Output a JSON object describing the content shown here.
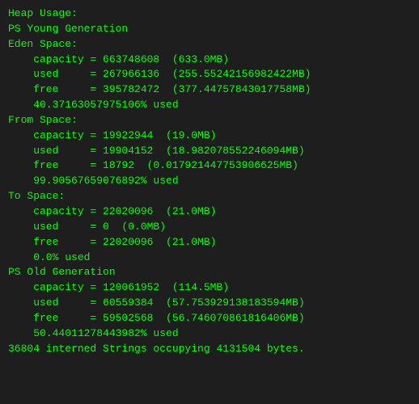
{
  "content": {
    "lines": [
      {
        "text": "Heap Usage:",
        "indent": 0
      },
      {
        "text": "PS Young Generation",
        "indent": 0
      },
      {
        "text": "Eden Space:",
        "indent": 0
      },
      {
        "text": "    capacity = 663748608  (633.0MB)",
        "indent": 0
      },
      {
        "text": "    used     = 267966136  (255.55242156982422MB)",
        "indent": 0
      },
      {
        "text": "    free     = 395782472  (377.44757843017758MB)",
        "indent": 0
      },
      {
        "text": "    40.37163057975106% used",
        "indent": 0
      },
      {
        "text": "From Space:",
        "indent": 0
      },
      {
        "text": "    capacity = 19922944  (19.0MB)",
        "indent": 0
      },
      {
        "text": "    used     = 19904152  (18.982078552246094MB)",
        "indent": 0
      },
      {
        "text": "    free     = 18792  (0.017921447753906625MB)",
        "indent": 0
      },
      {
        "text": "    99.90567659076892% used",
        "indent": 0
      },
      {
        "text": "To Space:",
        "indent": 0
      },
      {
        "text": "    capacity = 22020096  (21.0MB)",
        "indent": 0
      },
      {
        "text": "    used     = 0  (0.0MB)",
        "indent": 0
      },
      {
        "text": "    free     = 22020096  (21.0MB)",
        "indent": 0
      },
      {
        "text": "    0.0% used",
        "indent": 0
      },
      {
        "text": "PS Old Generation",
        "indent": 0
      },
      {
        "text": "    capacity = 120061952  (114.5MB)",
        "indent": 0
      },
      {
        "text": "    used     = 60559384  (57.753929138183594MB)",
        "indent": 0
      },
      {
        "text": "    free     = 59502568  (56.746070861816406MB)",
        "indent": 0
      },
      {
        "text": "    50.44011278443982% used",
        "indent": 0
      },
      {
        "text": "",
        "indent": 0
      },
      {
        "text": "36804 interned Strings occupying 4131504 bytes.",
        "indent": 0
      }
    ]
  }
}
